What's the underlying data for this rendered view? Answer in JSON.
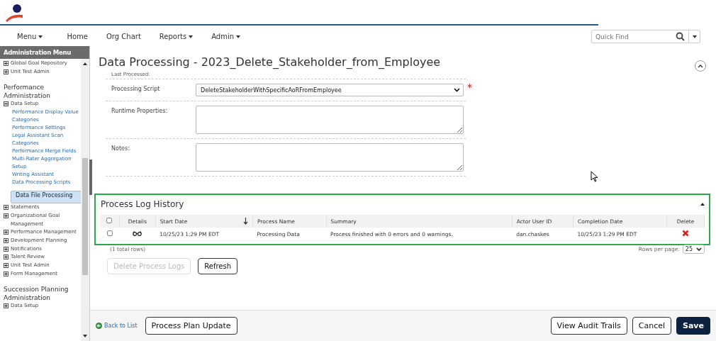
{
  "nav": {
    "items": [
      {
        "label": "Menu",
        "dropdown": true
      },
      {
        "label": "Home",
        "dropdown": false
      },
      {
        "label": "Org Chart",
        "dropdown": false
      },
      {
        "label": "Reports",
        "dropdown": true
      },
      {
        "label": "Admin",
        "dropdown": true
      }
    ],
    "search": {
      "placeholder": "Quick Find"
    }
  },
  "sidebar": {
    "title": "Administration Menu",
    "sections": [
      {
        "items": [
          {
            "label": "Global Goal Repository",
            "expanded": false
          },
          {
            "label": "Unit Test Admin",
            "expanded": false
          }
        ]
      },
      {
        "heading": "Performance Administration",
        "items": [
          {
            "label": "Data Setup",
            "expanded": true,
            "children": [
              {
                "label": "Performance Display Value Categories",
                "selected": false
              },
              {
                "label": "Performance Settings",
                "selected": false
              },
              {
                "label": "Legal Assistant Scan Categories",
                "selected": false
              },
              {
                "label": "Performance Merge Fields",
                "selected": false
              },
              {
                "label": "Multi-Rater Aggregation Setup",
                "selected": false
              },
              {
                "label": "Writing Assistant",
                "selected": false
              },
              {
                "label": "Data Processing Scripts",
                "selected": false
              },
              {
                "label": "Data File Processing",
                "selected": true
              }
            ]
          },
          {
            "label": "Statements",
            "expanded": false
          },
          {
            "label": "Organizational Goal Management",
            "expanded": false
          },
          {
            "label": "Performance Management",
            "expanded": false
          },
          {
            "label": "Development Planning",
            "expanded": false
          },
          {
            "label": "Notifications",
            "expanded": false
          },
          {
            "label": "Talent Review",
            "expanded": false
          },
          {
            "label": "Unit Test Admin",
            "expanded": false
          },
          {
            "label": "Form Management",
            "expanded": false
          }
        ]
      },
      {
        "heading": "Succession Planning Administration",
        "items": [
          {
            "label": "Data Setup",
            "expanded": false
          }
        ]
      }
    ]
  },
  "page": {
    "title": "Data Processing - 2023_Delete_Stakeholder_from_Employee"
  },
  "form": {
    "fields": [
      {
        "kind": "static",
        "label": "Last Processed:"
      },
      {
        "kind": "select",
        "label": "Processing Script",
        "value": "DeleteStakeholderWithSpecificAoRFromEmployee",
        "required": true,
        "required_mark": "*"
      },
      {
        "kind": "textarea",
        "label": "Runtime Properties:"
      },
      {
        "kind": "textarea",
        "label": "Notes:"
      }
    ]
  },
  "log": {
    "title": "Process Log History",
    "expanded": true,
    "columns": [
      {
        "label": "Details"
      },
      {
        "label": "Start Date",
        "sorted": true
      },
      {
        "label": "Process Name"
      },
      {
        "label": "Summary"
      },
      {
        "label": "Actor User ID"
      },
      {
        "label": "Completion Date"
      },
      {
        "label": "Delete"
      }
    ],
    "header_checked": false,
    "rows": [
      {
        "checked": false,
        "start_date": "10/25/23 1:29 PM EDT",
        "process_name": "Processing Data",
        "summary": "Process finished with 0 errors and 0 warnings.",
        "actor": "dan.chaskes",
        "completion_date": "10/25/23 1:29 PM EDT"
      }
    ],
    "total": "(1 total rows)",
    "rows_per_page_label": "Rows per page:",
    "rows_per_page": "25",
    "buttons": [
      {
        "label": "Delete Process Logs",
        "disabled": true
      },
      {
        "label": "Refresh",
        "disabled": false
      }
    ]
  },
  "footer": {
    "back_link": "Back to List",
    "left_buttons": [
      {
        "label": "Process Plan Update"
      }
    ],
    "right_buttons": [
      {
        "label": "View Audit Trails",
        "kind": "default"
      },
      {
        "label": "Cancel",
        "kind": "default"
      },
      {
        "label": "Save",
        "kind": "primary"
      }
    ]
  }
}
